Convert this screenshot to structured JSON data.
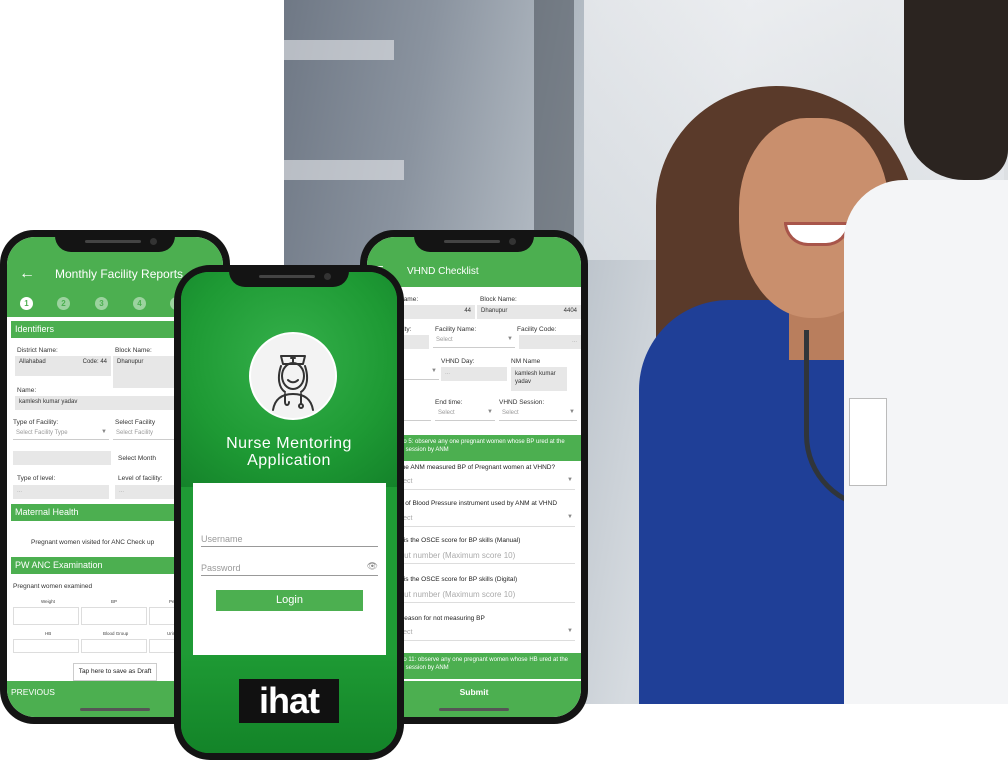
{
  "left_phone": {
    "title": "Monthly Facility Reports",
    "back_icon": "arrow-left-icon",
    "steps": [
      "1",
      "2",
      "3",
      "4",
      "5"
    ],
    "sections": {
      "identifiers": "Identifiers",
      "maternal_health": "Maternal Health",
      "pw_anc": "PW ANC Examination"
    },
    "district_label": "District Name:",
    "district_value": "Allahabad",
    "district_code": "Code: 44",
    "block_label": "Block Name:",
    "block_value": "Dhanupur",
    "name_label": "Name:",
    "name_value": "kamlesh kumar yadav",
    "name_code_fragment": "Co",
    "type_facility_label": "Type of Facility:",
    "type_facility_placeholder": "Select Facility Type",
    "select_facility_label": "Select Facility",
    "select_facility_placeholder": "Select Facility",
    "select_month": "Select Month",
    "type_level_label": "Type of level:",
    "type_level_value": "...",
    "level_facility_label": "Level of facility:",
    "level_facility_value": "...",
    "anc_checkup": "Pregnant women visited for ANC Check up",
    "pw_examined": "Pregnant women examined",
    "col_weight": "Weight",
    "col_bp": "BP",
    "col_per": "Per",
    "col_hb": "HB",
    "col_blood": "Blood Group",
    "col_uri": "Urin",
    "draft_button": "Tap here to save as Draft",
    "previous": "PREVIOUS"
  },
  "center_phone": {
    "app_title_line1": "Nurse Mentoring",
    "app_title_line2": "Application",
    "logo_icon": "nurse-icon",
    "username_placeholder": "Username",
    "password_placeholder": "Password",
    "eye_icon": "eye-icon",
    "login_button": "Login",
    "brand": "ihat"
  },
  "right_phone": {
    "title": "VHND Checklist",
    "menu_icon": "hamburger-menu-icon",
    "district_label": "Name:",
    "district_value": "d",
    "district_code": "44",
    "block_label": "Block Name:",
    "block_value": "Dhanupur",
    "block_code": "4404",
    "facility_type_label": "cility:",
    "facility_name_label": "Facility Name:",
    "facility_name_placeholder": "Select",
    "facility_code_label": "Facility Code:",
    "facility_code_value": "...",
    "date_label": "e:",
    "vhnd_day_label": "VHND Day:",
    "vhnd_day_value": "...",
    "nm_name_label": "NM Name",
    "nm_name_value": "kamlesh kumar yadav",
    "start_time_label": ":",
    "end_time_label": "End time:",
    "end_time_placeholder": "Select",
    "session_label": "VHND Session:",
    "session_placeholder": "Select",
    "note1": "ion 1 to 5: observe any one pregnant women whose BP ured at the VHND session by ANM",
    "q1": "id the ANM measured BP of Pregnant women at VHND?",
    "q1_placeholder": "Select",
    "q2": "ype of Blood Pressure instrument used by ANM at VHND",
    "q2_placeholder": "Select",
    "q3": "hat is the OSCE score for BP skills (Manual)",
    "q3_placeholder": "Input number (Maximum score 10)",
    "q4": "hat is the OSCE score for BP skills (Digital)",
    "q4_placeholder": "Input number (Maximum score 10)",
    "q5": "he reason for not measuring BP",
    "q5_placeholder": "Select",
    "note2": "ion 6 to 11: observe any one pregnant women whose HB ured at the VHND session by ANM",
    "submit": "Submit"
  },
  "colors": {
    "brand_green": "#4caf50",
    "splash_green": "#1f9a35"
  }
}
